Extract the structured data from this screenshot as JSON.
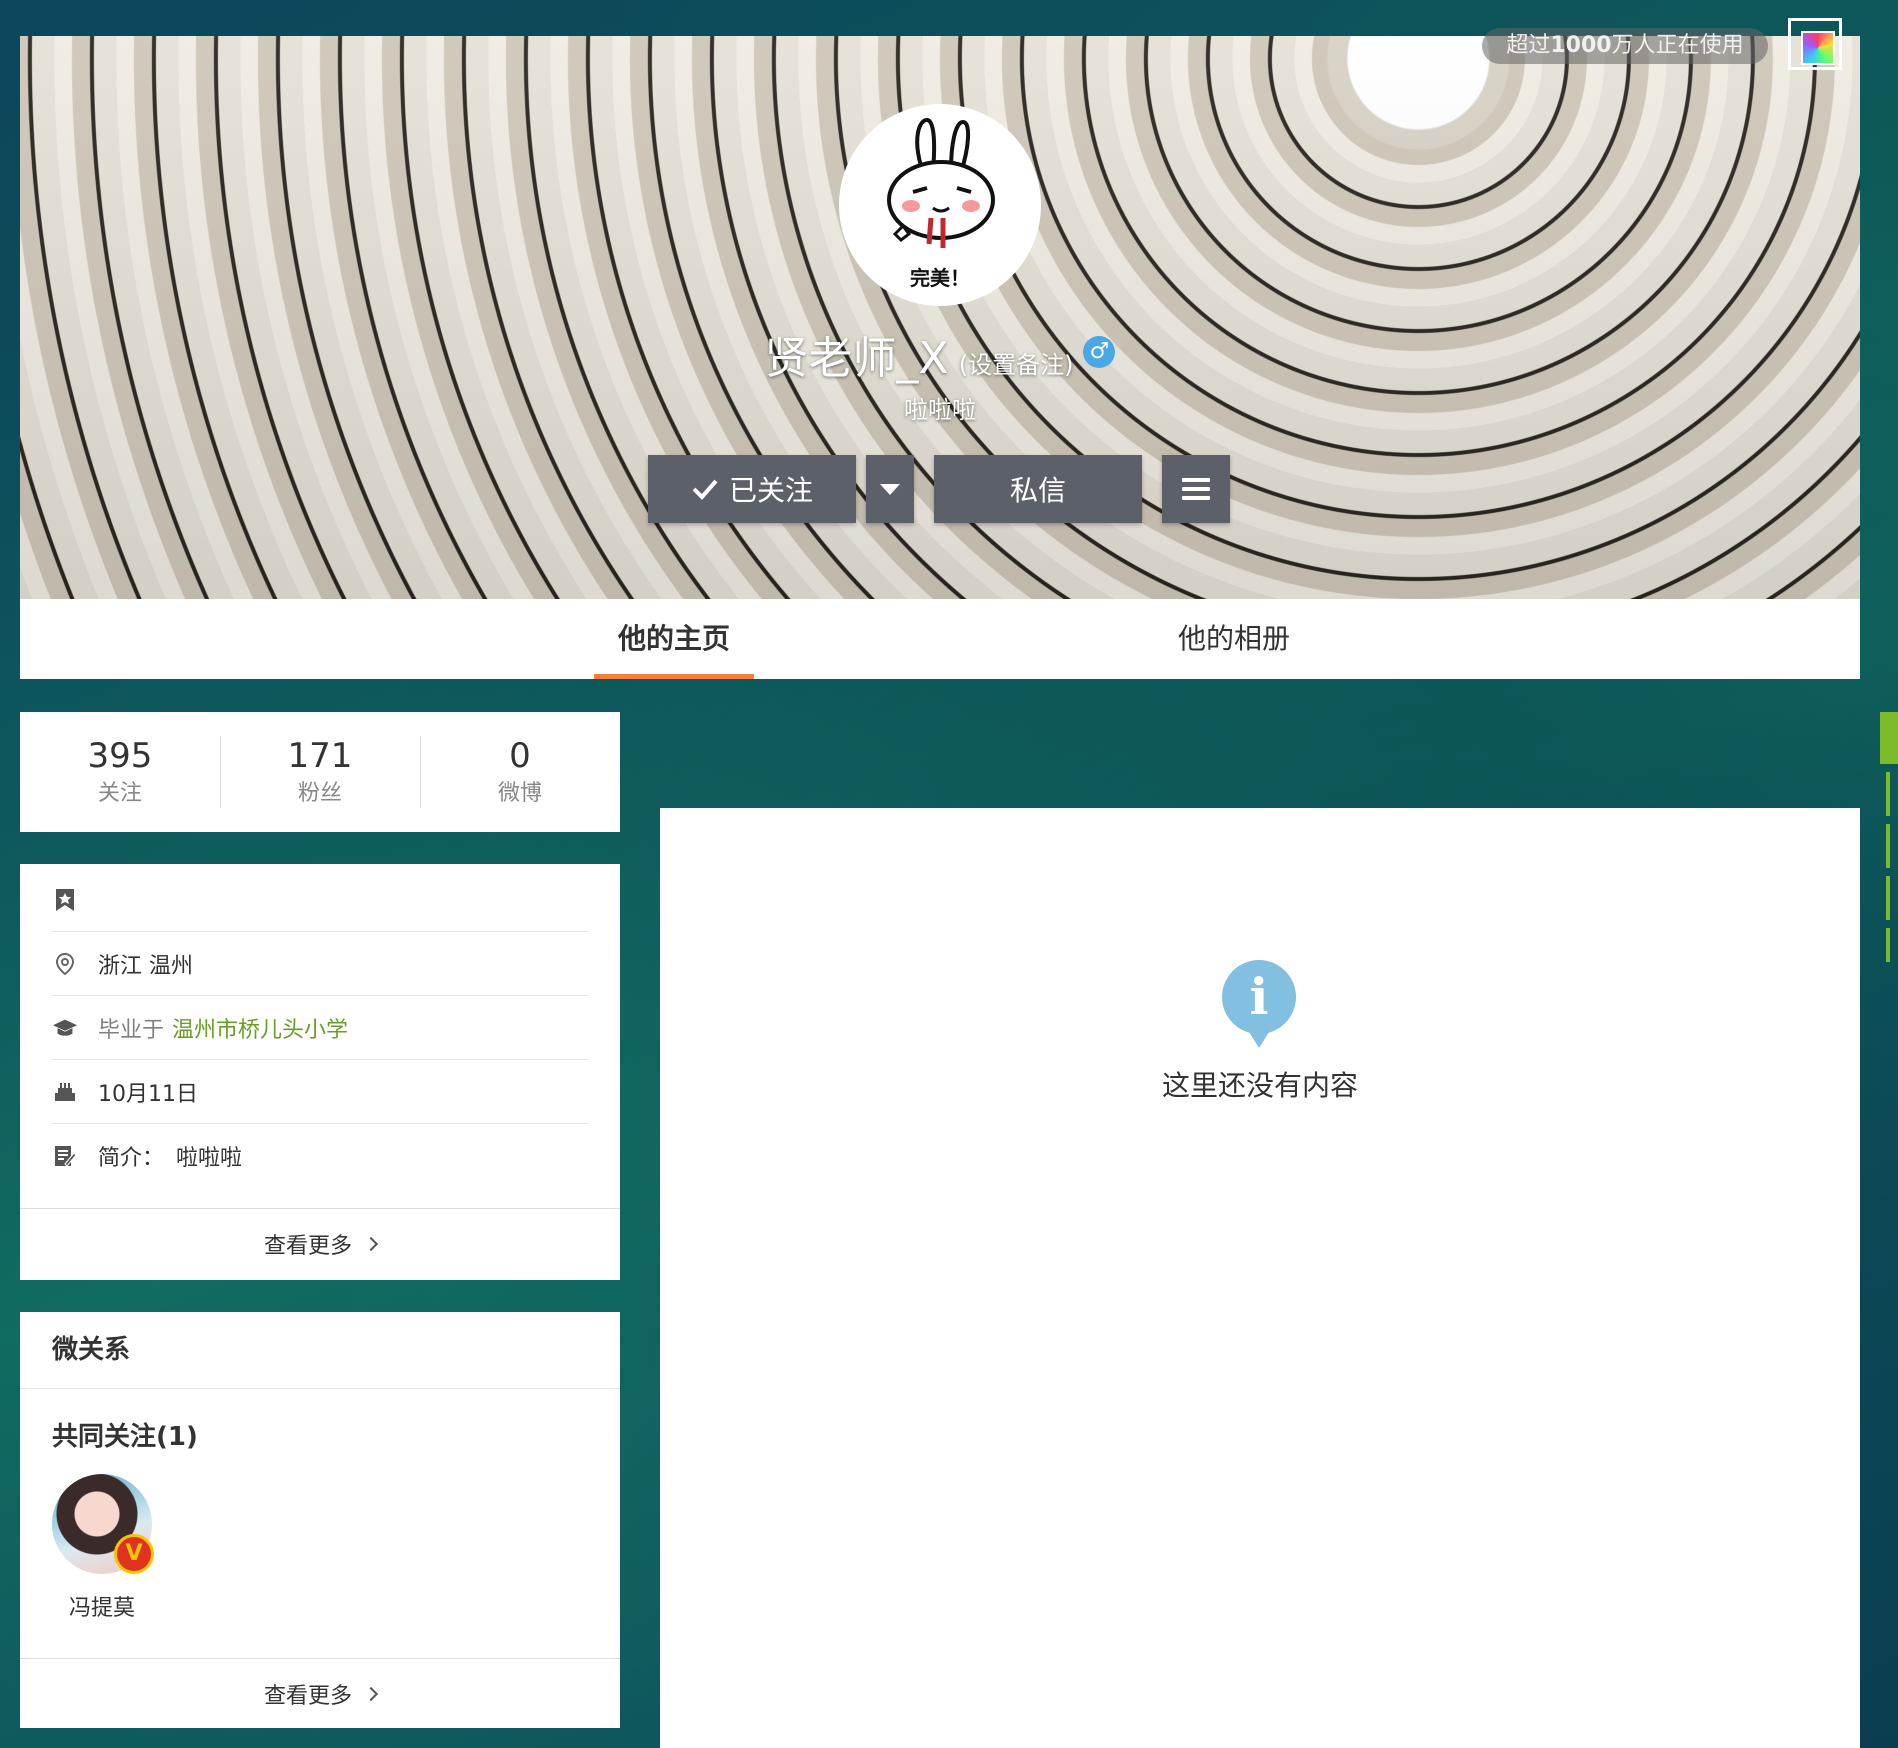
{
  "header": {
    "usage_prefix": "超过",
    "usage_count": "1000",
    "usage_suffix": "万人正在使用",
    "skin_icon": "palette-icon"
  },
  "profile": {
    "avatar_caption": "完美！",
    "username": "贤老师_X",
    "remark_label": "(设置备注)",
    "gender": "male",
    "gender_symbol": "♂",
    "signature": "啦啦啦",
    "follow_button": "已关注",
    "message_button": "私信"
  },
  "tabs": [
    {
      "label": "他的主页",
      "active": true
    },
    {
      "label": "他的相册",
      "active": false
    }
  ],
  "stats": [
    {
      "value": "395",
      "label": "关注"
    },
    {
      "value": "171",
      "label": "粉丝"
    },
    {
      "value": "0",
      "label": "微博"
    }
  ],
  "info": {
    "location": "浙江 温州",
    "education_prefix": "毕业于",
    "school": "温州市桥儿头小学",
    "birthday": "10月11日",
    "bio_label": "简介：",
    "bio": "啦啦啦",
    "see_more": "查看更多"
  },
  "relations": {
    "title": "微关系",
    "common_follow": "共同关注(1)",
    "friends": [
      {
        "name": "冯提莫",
        "verified": true,
        "badge": "V"
      }
    ],
    "see_more": "查看更多"
  },
  "feed": {
    "empty_text": "这里还没有内容",
    "empty_icon_glyph": "i"
  },
  "colors": {
    "tab_active": "#fa7d3c",
    "link_green": "#6b9f24",
    "button_bg": "#5c6068",
    "info_blue": "#82bfe0"
  }
}
